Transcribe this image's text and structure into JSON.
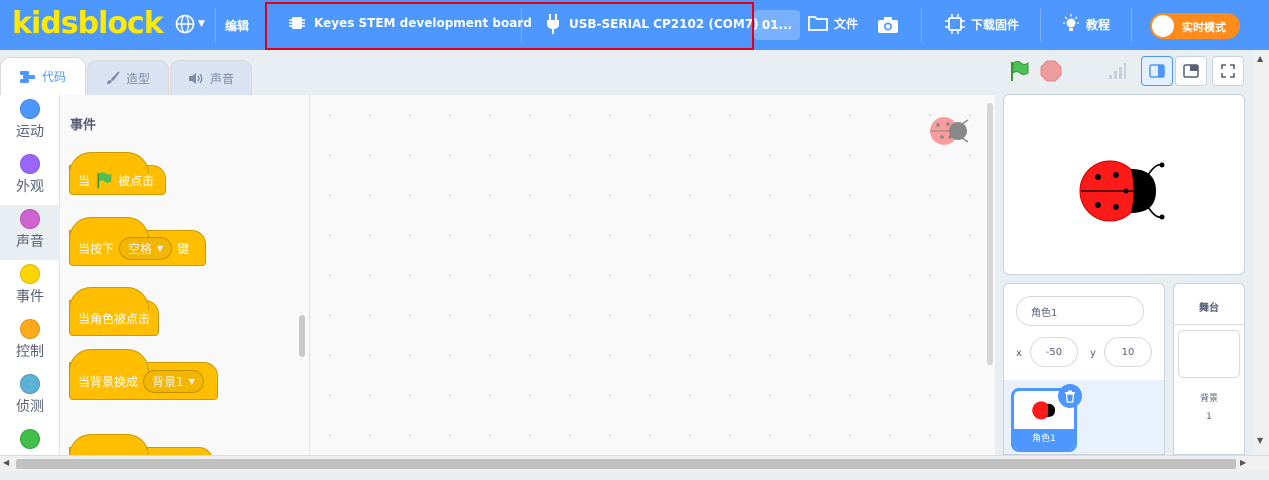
{
  "app": {
    "logo": "kidsblock"
  },
  "menubar": {
    "edit_label": "编辑",
    "board_label": "Keyes STEM development board",
    "port_label": "USB-SERIAL CP2102 (COM7)",
    "project_name": "01...",
    "file_label": "文件",
    "firmware_label": "下载固件",
    "tutorial_label": "教程",
    "realtime_label": "实时模式"
  },
  "tabs": [
    {
      "label": "代码"
    },
    {
      "label": "造型"
    },
    {
      "label": "声音"
    }
  ],
  "categories": [
    {
      "label": "运动",
      "color": "#4c97ff"
    },
    {
      "label": "外观",
      "color": "#9966ff"
    },
    {
      "label": "声音",
      "color": "#cf63cf"
    },
    {
      "label": "事件",
      "color": "#ffd500"
    },
    {
      "label": "控制",
      "color": "#ffab19"
    },
    {
      "label": "侦测",
      "color": "#5cb1d6"
    },
    {
      "label": "",
      "color": "#40bf4a"
    }
  ],
  "palette": {
    "section_title": "事件",
    "blocks": [
      {
        "prefix": "当",
        "suffix": "被点击"
      },
      {
        "prefix": "当按下",
        "dropdown": "空格",
        "suffix": "键"
      },
      {
        "prefix": "当角色被点击"
      },
      {
        "prefix": "当背景换成",
        "dropdown": "背景1"
      }
    ]
  },
  "sprite_info": {
    "name": "角色1",
    "x_label": "x",
    "x_value": "-50",
    "y_label": "y",
    "y_value": "10",
    "thumb_label": "角色1"
  },
  "stage_info": {
    "title": "舞台",
    "backdrops_label": "背景",
    "backdrops_count": "1"
  },
  "colors": {
    "menubar": "#4d97ff",
    "logo": "#ffeb00",
    "highlight_border": "#e0001b",
    "event_block": "#ffbf00"
  }
}
